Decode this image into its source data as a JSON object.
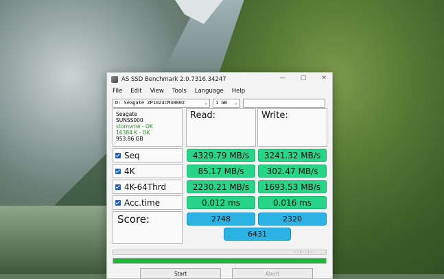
{
  "window": {
    "title": "AS SSD Benchmark 2.0.7316.34247",
    "controls": [
      "—",
      "□",
      "✕"
    ]
  },
  "menu": [
    "File",
    "Edit",
    "View",
    "Tools",
    "Language",
    "Help"
  ],
  "selectors": {
    "drive": "D: Seagate ZP1024CM30002",
    "size": "1 GB",
    "filter": ""
  },
  "drive_info": {
    "vendor": "Seagate",
    "firmware": "SUNSS000",
    "driver": "stornvme - OK",
    "alignment": "16384 K - OK",
    "capacity": "953.86 GB"
  },
  "headers": {
    "read": "Read:",
    "write": "Write:"
  },
  "tests": [
    {
      "name": "Seq",
      "checked": true,
      "read": "4329.79 MB/s",
      "write": "3241.32 MB/s"
    },
    {
      "name": "4K",
      "checked": true,
      "read": "85.17 MB/s",
      "write": "302.47 MB/s"
    },
    {
      "name": "4K-64Thrd",
      "checked": true,
      "read": "2230.21 MB/s",
      "write": "1693.53 MB/s"
    },
    {
      "name": "Acc.time",
      "checked": true,
      "read": "0.012 ms",
      "write": "0.016 ms"
    }
  ],
  "score": {
    "label": "Score:",
    "read": "2748",
    "write": "2320",
    "total": "6431"
  },
  "status": {
    "time_readout": "--:--:--",
    "progress_fraction": 1.0
  },
  "buttons": {
    "start": "Start",
    "abort": "Abort"
  },
  "colors": {
    "result_green": "#27d488",
    "score_blue": "#2bb3e6",
    "progress_green": "#1fb83a",
    "checkbox_blue": "#1f5fb8"
  }
}
